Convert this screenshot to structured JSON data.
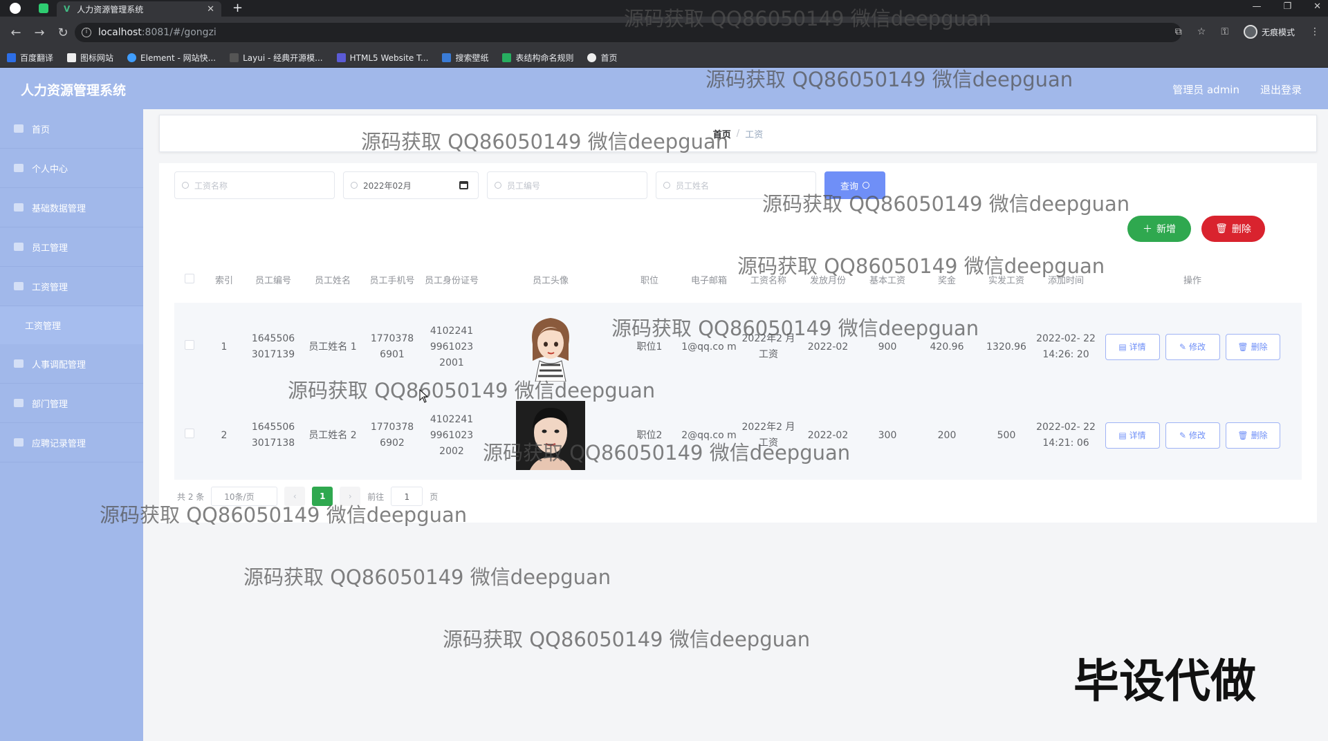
{
  "browser": {
    "tab_title": "人力资源管理系统",
    "url_host": "localhost",
    "url_path": ":8081/#/gongzi",
    "incognito_label": "无痕模式",
    "bookmarks": [
      "百度翻译",
      "图标网站",
      "Element - 网站快...",
      "Layui - 经典开源模...",
      "HTML5 Website T...",
      "搜索壁纸",
      "表结构命名规则",
      "首页"
    ]
  },
  "app": {
    "title": "人力资源管理系统",
    "user_label": "管理员 admin",
    "logout_label": "退出登录"
  },
  "sidebar": {
    "items": [
      {
        "label": "首页"
      },
      {
        "label": "个人中心"
      },
      {
        "label": "基础数据管理"
      },
      {
        "label": "员工管理"
      },
      {
        "label": "工资管理"
      },
      {
        "label": "工资管理"
      },
      {
        "label": "人事调配管理"
      },
      {
        "label": "部门管理"
      },
      {
        "label": "应聘记录管理"
      }
    ]
  },
  "breadcrumb": {
    "home": "首页",
    "sep": "/",
    "current": "工资"
  },
  "search": {
    "salary_name_placeholder": "工资名称",
    "month_value": "2022年02月",
    "emp_no_placeholder": "员工编号",
    "emp_name_placeholder": "员工姓名",
    "query_label": "查询"
  },
  "actions": {
    "add_label": "新增",
    "delete_label": "删除"
  },
  "table": {
    "headers": [
      "索引",
      "员工编号",
      "员工姓名",
      "员工手机号",
      "员工身份证号",
      "员工头像",
      "职位",
      "电子邮箱",
      "工资名称",
      "发放月份",
      "基本工资",
      "奖金",
      "实发工资",
      "添加时间",
      "操作"
    ],
    "rows": [
      {
        "index": "1",
        "emp_no": "1645506 3017139",
        "emp_name": "员工姓名 1",
        "phone": "1770378 6901",
        "id_card": "4102241 9961023 2001",
        "position": "职位1",
        "email": "1@qq.co m",
        "salary_name": "2022年2 月工资",
        "month": "2022-02",
        "base": "900",
        "bonus": "420.96",
        "real": "1320.96",
        "time": "2022-02- 22 14:26: 20"
      },
      {
        "index": "2",
        "emp_no": "1645506 3017138",
        "emp_name": "员工姓名 2",
        "phone": "1770378 6902",
        "id_card": "4102241 9961023 2002",
        "position": "职位2",
        "email": "2@qq.co m",
        "salary_name": "2022年2 月工资",
        "month": "2022-02",
        "base": "300",
        "bonus": "200",
        "real": "500",
        "time": "2022-02- 22 14:21: 06"
      }
    ],
    "op_labels": {
      "detail": "详情",
      "edit": "修改",
      "delete": "删除"
    }
  },
  "pagination": {
    "total": "共 2 条",
    "page_size": "10条/页",
    "current": "1",
    "goto_prefix": "前往",
    "goto_value": "1",
    "goto_suffix": "页"
  },
  "watermark": {
    "text": "源码获取 QQ86050149 微信deepguan",
    "big": "毕设代做"
  }
}
